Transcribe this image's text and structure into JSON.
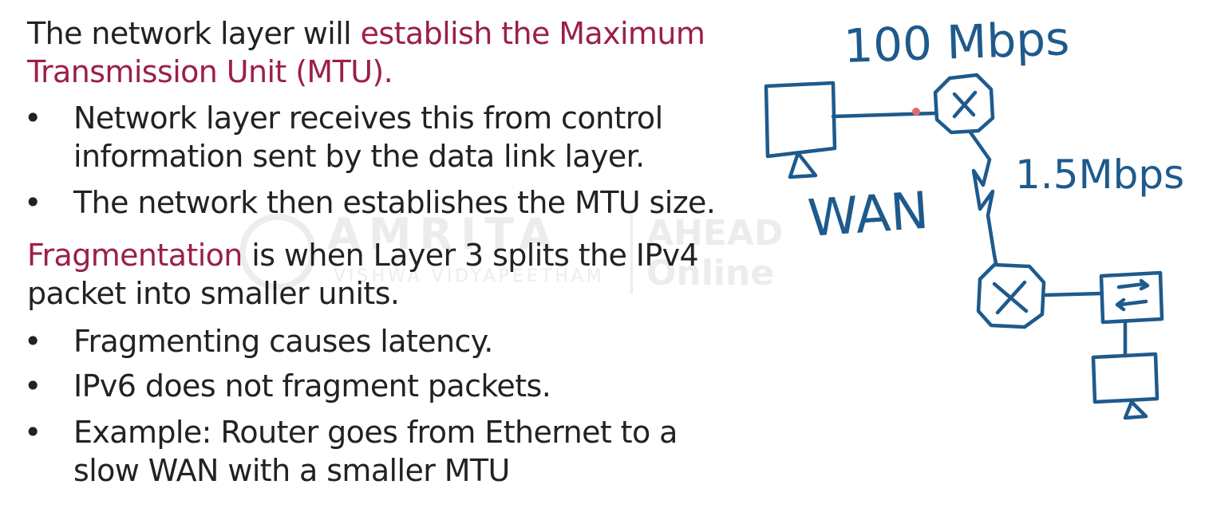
{
  "slide": {
    "intro": {
      "plain": "The network layer will ",
      "accent": "establish the Maximum",
      "accent_line2": "Transmission Unit (MTU)."
    },
    "bullets_group1": [
      {
        "marker": "•",
        "line1": "Network layer receives this from control",
        "line2": "information sent by the data link layer."
      },
      {
        "marker": "•",
        "line1": "The network then establishes the MTU size.",
        "line2": ""
      }
    ],
    "fragmentation": {
      "accent": "Fragmentation",
      "plain": " is when Layer 3 splits the IPv4",
      "line2": "packet into smaller units."
    },
    "bullets_group2": [
      {
        "marker": "•",
        "line1": "Fragmenting causes latency.",
        "line2": ""
      },
      {
        "marker": "•",
        "line1": "IPv6 does not fragment packets.",
        "line2": ""
      },
      {
        "marker": "•",
        "line1": "Example: Router goes from Ethernet to a",
        "line2": "slow WAN with a smaller MTU"
      }
    ],
    "accent_color": "#9b1f4a",
    "text_color": "#222222"
  },
  "watermark": {
    "main": "AMRITA",
    "sub": "VISHWA VIDYAPEETHAM",
    "right_line1": "AHEAD",
    "right_line2": "Online"
  },
  "annotations": {
    "speed_top": "100 Mbps",
    "speed_wan": "1.5Mbps",
    "wan_label": "WAN",
    "router_symbol": "X",
    "ink_color": "#1e5a8c"
  }
}
